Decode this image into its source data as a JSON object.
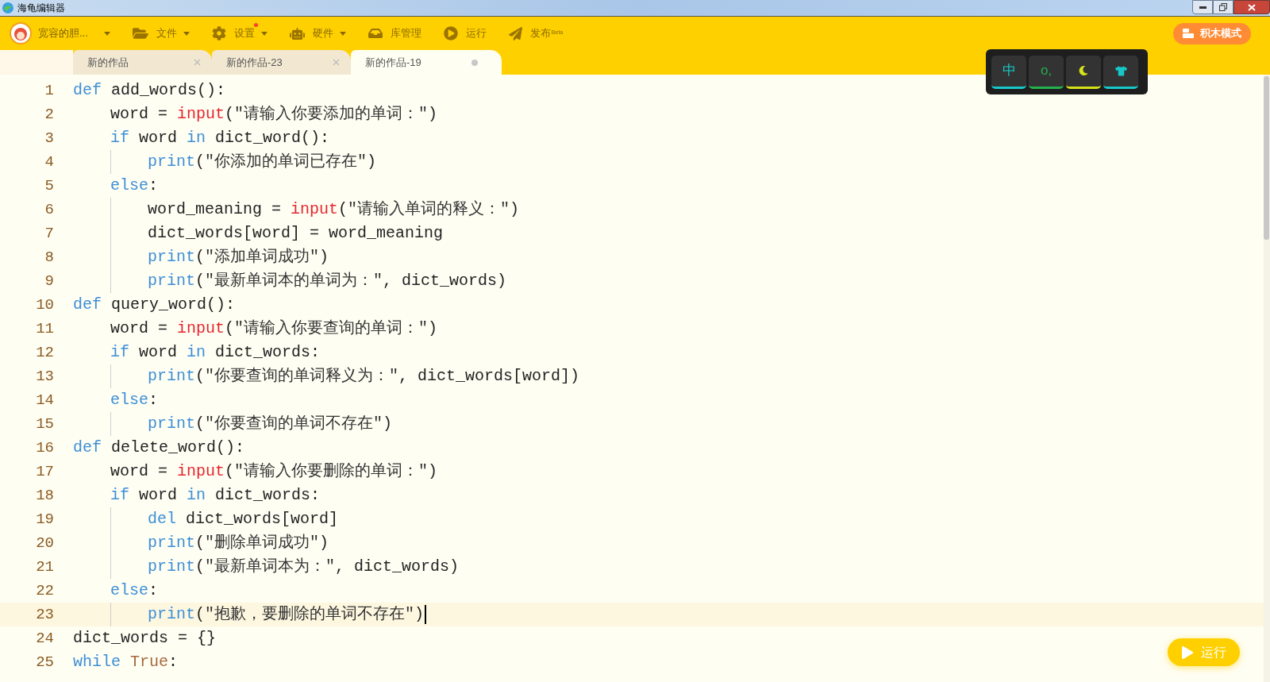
{
  "window": {
    "title": "海龟编辑器"
  },
  "toolbar": {
    "user": {
      "name": "宽容的胆..."
    },
    "items": [
      {
        "kind": "file",
        "label": "文件",
        "dropdown": true,
        "badge": false
      },
      {
        "kind": "settings",
        "label": "设置",
        "dropdown": true,
        "badge": true
      },
      {
        "kind": "hardware",
        "label": "硬件",
        "dropdown": true,
        "badge": false
      },
      {
        "kind": "library",
        "label": "库管理",
        "dropdown": false,
        "badge": false
      },
      {
        "kind": "run",
        "label": "运行",
        "dropdown": false,
        "badge": false
      },
      {
        "kind": "publish",
        "label": "发布",
        "tag": "Beta",
        "dropdown": false,
        "badge": false
      }
    ],
    "mode_button": "积木模式"
  },
  "tabs": [
    {
      "label": "新的作品",
      "selected": false,
      "modified": false
    },
    {
      "label": "新的作品-23",
      "selected": false,
      "modified": false
    },
    {
      "label": "新的作品-19",
      "selected": true,
      "modified": true
    }
  ],
  "keys_panel": [
    {
      "kind": "text",
      "label": "中",
      "color": "#18c8c8"
    },
    {
      "kind": "text",
      "label": "o,",
      "color": "#22b14c"
    },
    {
      "kind": "moon",
      "color": "#d6e21a"
    },
    {
      "kind": "shirt",
      "color": "#18c8c8"
    }
  ],
  "editor": {
    "lines": [
      {
        "number": "1",
        "current": false,
        "tokens": [
          {
            "kind": "keyword",
            "text": "def"
          },
          {
            "kind": "plain",
            "text": " add_words():"
          }
        ],
        "children": [
          {
            "number": "2",
            "current": false,
            "tokens": [
              {
                "kind": "plain",
                "text": "word = "
              },
              {
                "kind": "input",
                "text": "input"
              },
              {
                "kind": "plain",
                "text": "("
              },
              {
                "kind": "string",
                "text": "\"请输入你要添加的单词：\""
              },
              {
                "kind": "plain",
                "text": ")"
              }
            ]
          },
          {
            "number": "3",
            "current": false,
            "tokens": [
              {
                "kind": "keyword",
                "text": "if"
              },
              {
                "kind": "plain",
                "text": " word "
              },
              {
                "kind": "keyword",
                "text": "in"
              },
              {
                "kind": "plain",
                "text": " dict_word():"
              }
            ],
            "children": [
              {
                "number": "4",
                "current": false,
                "tokens": [
                  {
                    "kind": "builtin",
                    "text": "print"
                  },
                  {
                    "kind": "plain",
                    "text": "("
                  },
                  {
                    "kind": "string",
                    "text": "\"你添加的单词已存在\""
                  },
                  {
                    "kind": "plain",
                    "text": ")"
                  }
                ]
              }
            ]
          },
          {
            "number": "5",
            "current": false,
            "tokens": [
              {
                "kind": "keyword",
                "text": "else"
              },
              {
                "kind": "plain",
                "text": ":"
              }
            ],
            "children": [
              {
                "number": "6",
                "current": false,
                "tokens": [
                  {
                    "kind": "plain",
                    "text": "word_meaning = "
                  },
                  {
                    "kind": "input",
                    "text": "input"
                  },
                  {
                    "kind": "plain",
                    "text": "("
                  },
                  {
                    "kind": "string",
                    "text": "\"请输入单词的释义：\""
                  },
                  {
                    "kind": "plain",
                    "text": ")"
                  }
                ]
              },
              {
                "number": "7",
                "current": false,
                "tokens": [
                  {
                    "kind": "plain",
                    "text": "dict_words[word] = word_meaning"
                  }
                ]
              },
              {
                "number": "8",
                "current": false,
                "tokens": [
                  {
                    "kind": "builtin",
                    "text": "print"
                  },
                  {
                    "kind": "plain",
                    "text": "("
                  },
                  {
                    "kind": "string",
                    "text": "\"添加单词成功\""
                  },
                  {
                    "kind": "plain",
                    "text": ")"
                  }
                ]
              },
              {
                "number": "9",
                "current": false,
                "tokens": [
                  {
                    "kind": "builtin",
                    "text": "print"
                  },
                  {
                    "kind": "plain",
                    "text": "("
                  },
                  {
                    "kind": "string",
                    "text": "\"最新单词本的单词为：\""
                  },
                  {
                    "kind": "plain",
                    "text": ", dict_words)"
                  }
                ]
              }
            ]
          }
        ]
      },
      {
        "number": "10",
        "current": false,
        "tokens": [
          {
            "kind": "keyword",
            "text": "def"
          },
          {
            "kind": "plain",
            "text": " query_word():"
          }
        ],
        "children": [
          {
            "number": "11",
            "current": false,
            "tokens": [
              {
                "kind": "plain",
                "text": "word = "
              },
              {
                "kind": "input",
                "text": "input"
              },
              {
                "kind": "plain",
                "text": "("
              },
              {
                "kind": "string",
                "text": "\"请输入你要查询的单词：\""
              },
              {
                "kind": "plain",
                "text": ")"
              }
            ]
          },
          {
            "number": "12",
            "current": false,
            "tokens": [
              {
                "kind": "keyword",
                "text": "if"
              },
              {
                "kind": "plain",
                "text": " word "
              },
              {
                "kind": "keyword",
                "text": "in"
              },
              {
                "kind": "plain",
                "text": " dict_words:"
              }
            ],
            "children": [
              {
                "number": "13",
                "current": false,
                "tokens": [
                  {
                    "kind": "builtin",
                    "text": "print"
                  },
                  {
                    "kind": "plain",
                    "text": "("
                  },
                  {
                    "kind": "string",
                    "text": "\"你要查询的单词释义为：\""
                  },
                  {
                    "kind": "plain",
                    "text": ", dict_words[word])"
                  }
                ]
              }
            ]
          },
          {
            "number": "14",
            "current": false,
            "tokens": [
              {
                "kind": "keyword",
                "text": "else"
              },
              {
                "kind": "plain",
                "text": ":"
              }
            ],
            "children": [
              {
                "number": "15",
                "current": false,
                "tokens": [
                  {
                    "kind": "builtin",
                    "text": "print"
                  },
                  {
                    "kind": "plain",
                    "text": "("
                  },
                  {
                    "kind": "string",
                    "text": "\"你要查询的单词不存在\""
                  },
                  {
                    "kind": "plain",
                    "text": ")"
                  }
                ]
              }
            ]
          }
        ]
      },
      {
        "number": "16",
        "current": false,
        "tokens": [
          {
            "kind": "keyword",
            "text": "def"
          },
          {
            "kind": "plain",
            "text": " delete_word():"
          }
        ],
        "children": [
          {
            "number": "17",
            "current": false,
            "tokens": [
              {
                "kind": "plain",
                "text": "word = "
              },
              {
                "kind": "input",
                "text": "input"
              },
              {
                "kind": "plain",
                "text": "("
              },
              {
                "kind": "string",
                "text": "\"请输入你要删除的单词：\""
              },
              {
                "kind": "plain",
                "text": ")"
              }
            ]
          },
          {
            "number": "18",
            "current": false,
            "tokens": [
              {
                "kind": "keyword",
                "text": "if"
              },
              {
                "kind": "plain",
                "text": " word "
              },
              {
                "kind": "keyword",
                "text": "in"
              },
              {
                "kind": "plain",
                "text": " dict_words:"
              }
            ],
            "children": [
              {
                "number": "19",
                "current": false,
                "tokens": [
                  {
                    "kind": "keyword",
                    "text": "del"
                  },
                  {
                    "kind": "plain",
                    "text": " dict_words[word]"
                  }
                ]
              },
              {
                "number": "20",
                "current": false,
                "tokens": [
                  {
                    "kind": "builtin",
                    "text": "print"
                  },
                  {
                    "kind": "plain",
                    "text": "("
                  },
                  {
                    "kind": "string",
                    "text": "\"删除单词成功\""
                  },
                  {
                    "kind": "plain",
                    "text": ")"
                  }
                ]
              },
              {
                "number": "21",
                "current": false,
                "tokens": [
                  {
                    "kind": "builtin",
                    "text": "print"
                  },
                  {
                    "kind": "plain",
                    "text": "("
                  },
                  {
                    "kind": "string",
                    "text": "\"最新单词本为：\""
                  },
                  {
                    "kind": "plain",
                    "text": ", dict_words)"
                  }
                ]
              }
            ]
          },
          {
            "number": "22",
            "current": false,
            "tokens": [
              {
                "kind": "keyword",
                "text": "else"
              },
              {
                "kind": "plain",
                "text": ":"
              }
            ],
            "children": [
              {
                "number": "23",
                "current": true,
                "tokens": [
                  {
                    "kind": "builtin",
                    "text": "print"
                  },
                  {
                    "kind": "plain",
                    "text": "("
                  },
                  {
                    "kind": "string",
                    "text": "\"抱歉，要删除的单词不存在\""
                  },
                  {
                    "kind": "plain",
                    "text": ")"
                  }
                ]
              }
            ]
          }
        ]
      },
      {
        "number": "24",
        "current": false,
        "tokens": [
          {
            "kind": "plain",
            "text": "dict_words = {}"
          }
        ]
      },
      {
        "number": "25",
        "current": false,
        "tokens": [
          {
            "kind": "keyword",
            "text": "while"
          },
          {
            "kind": "constant",
            "text": " True"
          },
          {
            "kind": "plain",
            "text": ":"
          }
        ]
      }
    ]
  },
  "run_button": "运行"
}
